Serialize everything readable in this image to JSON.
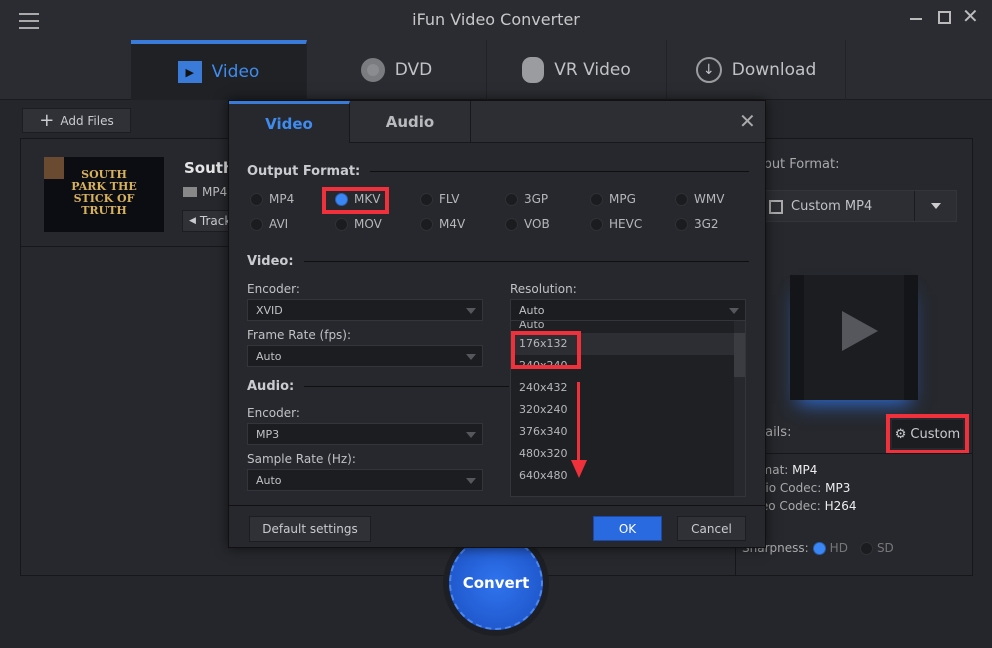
{
  "app": {
    "title": "iFun Video Converter"
  },
  "main_tabs": [
    {
      "label": "Video",
      "icon": "video-icon"
    },
    {
      "label": "DVD",
      "icon": "disc-icon"
    },
    {
      "label": "VR Video",
      "icon": "vr-headset-icon"
    },
    {
      "label": "Download",
      "icon": "download-icon"
    }
  ],
  "toolbar": {
    "add_files": "Add Files"
  },
  "file": {
    "title": "South",
    "format": "MP4",
    "track": "Track",
    "thumbnail_text": "SOUTH PARK THE STICK OF TRUTH"
  },
  "right_panel": {
    "output_format_label": "Output Format:",
    "selected_format": "Custom MP4",
    "details_label": "Details:",
    "custom_button": "Custom",
    "format_label": "Format:",
    "format_value": "MP4",
    "audio_codec_label": "Audio Codec:",
    "audio_codec_value": "MP3",
    "video_codec_label": "Video Codec:",
    "video_codec_value": "H264",
    "sharpness_label": "Sharpness:",
    "sharpness_options": [
      "HD",
      "SD"
    ],
    "sharpness_selected": "HD"
  },
  "convert": {
    "label": "Convert"
  },
  "dialog": {
    "tabs": [
      "Video",
      "Audio"
    ],
    "active_tab": "Video",
    "output_format_label": "Output Format:",
    "formats": [
      "MP4",
      "MKV",
      "FLV",
      "3GP",
      "MPG",
      "WMV",
      "AVI",
      "MOV",
      "M4V",
      "VOB",
      "HEVC",
      "3G2"
    ],
    "selected_format": "MKV",
    "video_label": "Video:",
    "video_encoder_label": "Encoder:",
    "video_encoder": "XVID",
    "frame_rate_label": "Frame Rate (fps):",
    "frame_rate": "Auto",
    "resolution_label": "Resolution:",
    "resolution": "Auto",
    "resolution_options": [
      "Auto",
      "176x132",
      "240x240",
      "240x432",
      "320x240",
      "376x340",
      "480x320",
      "640x480"
    ],
    "resolution_highlighted": "176x132",
    "audio_label": "Audio:",
    "audio_encoder_label": "Encoder:",
    "audio_encoder": "MP3",
    "sample_rate_label": "Sample Rate (Hz):",
    "sample_rate": "Auto",
    "default_settings": "Default settings",
    "ok": "OK",
    "cancel": "Cancel"
  },
  "colors": {
    "accent": "#3a86f5",
    "highlight": "#f0303a"
  }
}
